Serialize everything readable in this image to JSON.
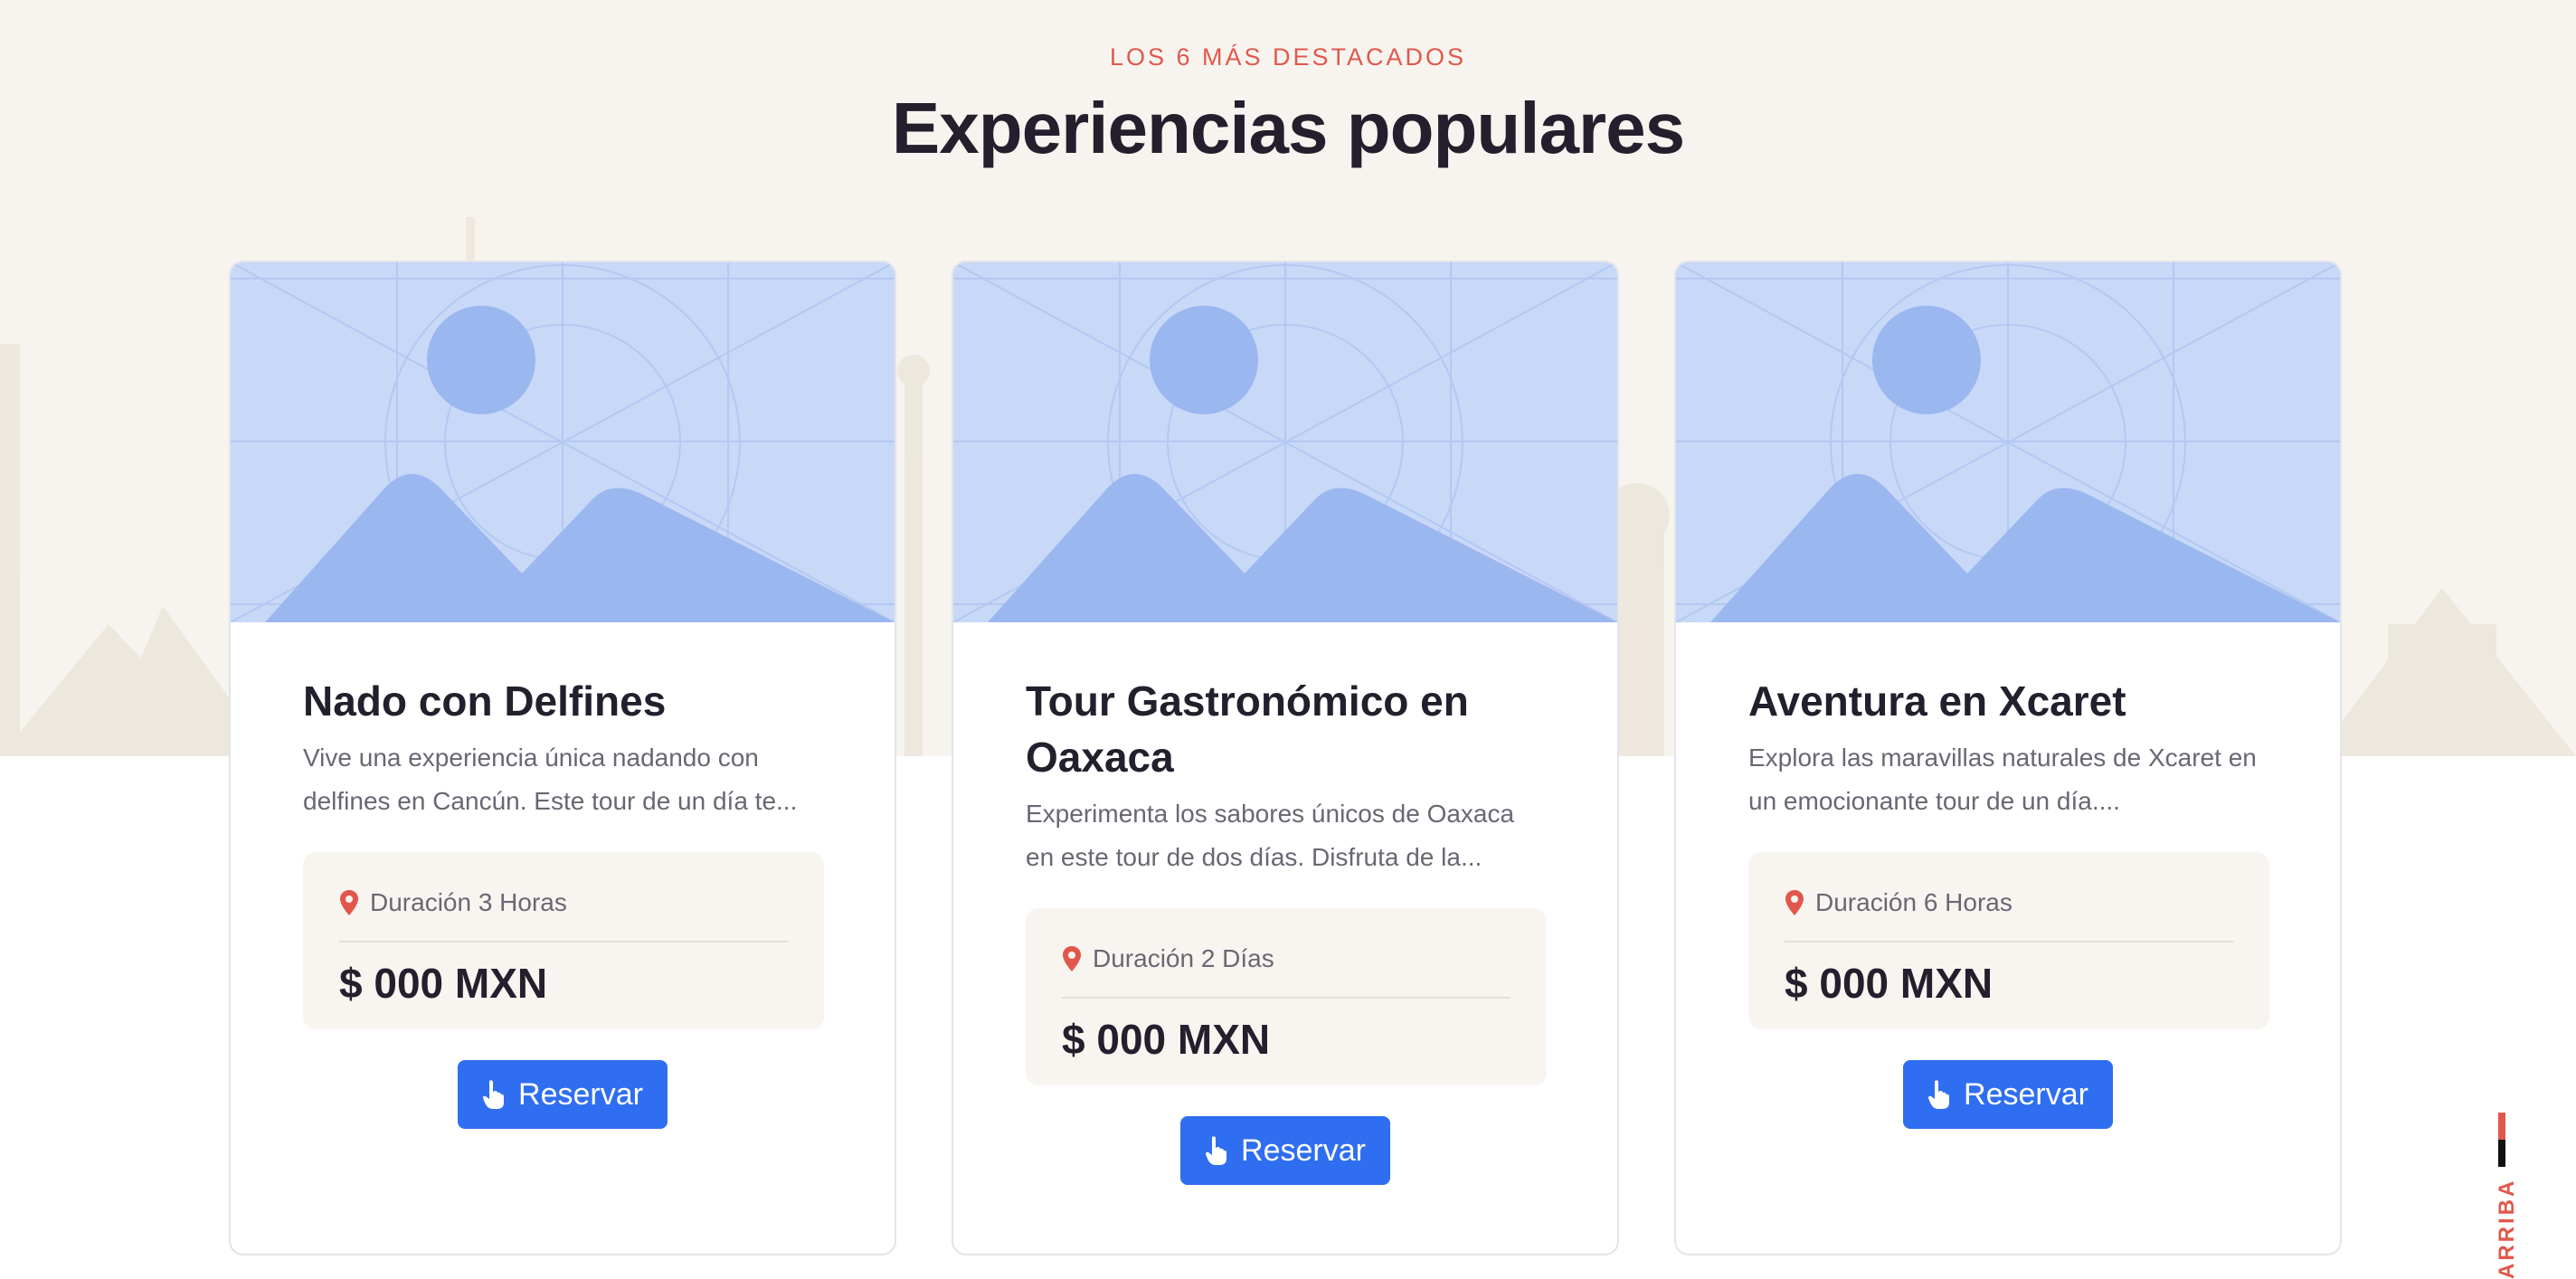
{
  "section": {
    "eyebrow": "LOS 6 MÁS DESTACADOS",
    "title": "Experiencias populares"
  },
  "cards": [
    {
      "title": "Nado con Delfines",
      "description": "Vive una experiencia única nadando con delfines en Cancún. Este tour de un día te...",
      "duration": "Duración 3 Horas",
      "price": "$ 000 MXN",
      "button": "Reservar"
    },
    {
      "title": "Tour Gastronómico en Oaxaca",
      "description": "Experimenta los sabores únicos de Oaxaca en este tour de dos días. Disfruta de la...",
      "duration": "Duración 2 Días",
      "price": "$ 000 MXN",
      "button": "Reservar"
    },
    {
      "title": "Aventura en Xcaret",
      "description": "Explora las maravillas naturales de Xcaret en un emocionante tour de un día....",
      "duration": "Duración 6 Horas",
      "price": "$ 000 MXN",
      "button": "Reservar"
    }
  ],
  "back_to_top": "ARRIBA",
  "colors": {
    "accent": "#e2574c",
    "button": "#2f6ef0",
    "heading": "#241f2d",
    "placeholder_bg": "#c8d8f7",
    "placeholder_shape": "#9bb7f0"
  },
  "icons": {
    "duration": "map-pin-icon",
    "button": "hand-pointer-icon",
    "media": "image-placeholder-icon"
  }
}
